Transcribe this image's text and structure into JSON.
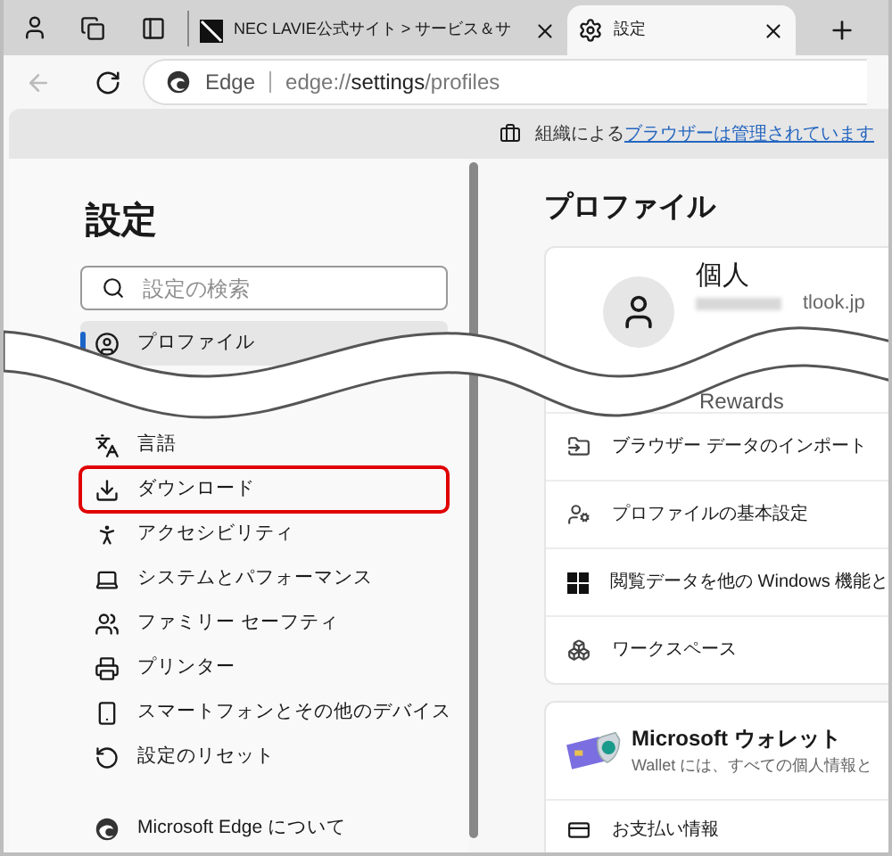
{
  "tabs": [
    {
      "kind": "page",
      "title": "NEC LAVIE公式サイト > サービス＆サ",
      "selected": false
    },
    {
      "kind": "settings",
      "title": "設定",
      "selected": true
    }
  ],
  "address_bar": {
    "site_label": "Edge",
    "url": "edge://**settings**/profiles"
  },
  "managed_notice": {
    "text": "組織による",
    "link": "ブラウザーは管理されています"
  },
  "sidebar": {
    "title": "設定",
    "search": {
      "placeholder": "設定の検索"
    },
    "sections": [
      {
        "items": [
          {
            "label": "プロファイル",
            "selected": true,
            "highlighted": false
          }
        ]
      },
      {
        "items": [
          {
            "label": "言語",
            "selected": false,
            "highlighted": false
          },
          {
            "label": "ダウンロード",
            "selected": false,
            "highlighted": true
          },
          {
            "label": "アクセシビリティ",
            "selected": false,
            "highlighted": false
          },
          {
            "label": "システムとパフォーマンス",
            "selected": false,
            "highlighted": false
          },
          {
            "label": "ファミリー セーフティ",
            "selected": false,
            "highlighted": false
          },
          {
            "label": "プリンター",
            "selected": false,
            "highlighted": false
          },
          {
            "label": "スマートフォンとその他のデバイス",
            "selected": false,
            "highlighted": false
          },
          {
            "label": "設定のリセット",
            "selected": false,
            "highlighted": false
          }
        ]
      },
      {
        "items": [
          {
            "label": "Microsoft Edge について",
            "selected": false,
            "highlighted": false
          }
        ]
      }
    ]
  },
  "main": {
    "title": "プロファイル",
    "profile_card": {
      "name": "個人",
      "email": "tlook.jp",
      "rewards": "Rewards",
      "rows": [
        "ブラウザー データのインポート",
        "プロファイルの基本設定",
        "閲覧データを他の Windows 機能と",
        "ワークスペース"
      ]
    },
    "wallet_card": {
      "title": "Microsoft ウォレット",
      "description": "Wallet には、すべての個人情報と",
      "rows": [
        "お支払い情報"
      ]
    }
  }
}
